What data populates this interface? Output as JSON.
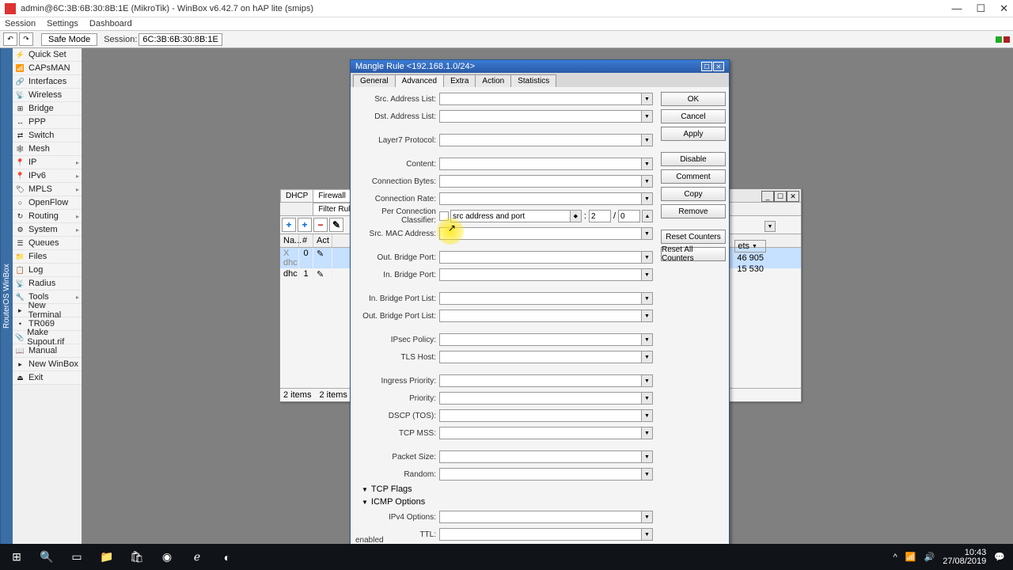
{
  "titlebar": {
    "title": "admin@6C:3B:6B:30:8B:1E (MikroTik) - WinBox v6.42.7 on hAP lite (smips)"
  },
  "menubar": [
    "Session",
    "Settings",
    "Dashboard"
  ],
  "toolbar": {
    "safemode": "Safe Mode",
    "sessionlabel": "Session:",
    "sessionid": "6C:3B:6B:30:8B:1E"
  },
  "nav": [
    "Quick Set",
    "CAPsMAN",
    "Interfaces",
    "Wireless",
    "Bridge",
    "PPP",
    "Switch",
    "Mesh",
    "IP",
    "IPv6",
    "MPLS",
    "OpenFlow",
    "Routing",
    "System",
    "Queues",
    "Files",
    "Log",
    "Radius",
    "Tools",
    "New Terminal",
    "TR069",
    "Make Supout.rif",
    "Manual",
    "New WinBox",
    "Exit"
  ],
  "sidetitle": "RouterOS WinBox",
  "winback": {
    "tabs": [
      "DHCP",
      "Firewall"
    ],
    "subtab": "Filter Rules",
    "headers": {
      "name": "Na...",
      "hash": "#",
      "act": "Act"
    },
    "rows": [
      {
        "name": "dhc",
        "hash": "0",
        "disabled": true
      },
      {
        "name": "dhc",
        "hash": "1",
        "disabled": false
      }
    ],
    "status1": "2 items",
    "status2": "2 items (1 sel",
    "rightvals": [
      "ets",
      "46 905",
      "15 530"
    ]
  },
  "dialog": {
    "title": "Mangle Rule <192.168.1.0/24>",
    "tabs": [
      "General",
      "Advanced",
      "Extra",
      "Action",
      "Statistics"
    ],
    "activeTab": "Advanced",
    "labels": {
      "srcAddrList": "Src. Address List:",
      "dstAddrList": "Dst. Address List:",
      "layer7": "Layer7 Protocol:",
      "content": "Content:",
      "connBytes": "Connection Bytes:",
      "connRate": "Connection Rate:",
      "pcc": "Per Connection Classifier:",
      "srcMac": "Src. MAC Address:",
      "outBridge": "Out. Bridge Port:",
      "inBridge": "In. Bridge Port:",
      "inBridgeList": "In. Bridge Port List:",
      "outBridgeList": "Out. Bridge Port List:",
      "ipsec": "IPsec Policy:",
      "tls": "TLS Host:",
      "ingress": "Ingress Priority:",
      "priority": "Priority:",
      "dscp": "DSCP (TOS):",
      "tcpmss": "TCP MSS:",
      "packetSize": "Packet Size:",
      "random": "Random:",
      "ipv4": "IPv4 Options:",
      "ttl": "TTL:"
    },
    "pcc": {
      "type": "src address and port",
      "num": "2",
      "den": "0"
    },
    "expands": [
      "TCP Flags",
      "ICMP Options"
    ],
    "buttons": [
      "OK",
      "Cancel",
      "Apply",
      "Disable",
      "Comment",
      "Copy",
      "Remove",
      "Reset Counters",
      "Reset All Counters"
    ],
    "status": "enabled"
  },
  "taskbar": {
    "clock": {
      "time": "10:43",
      "date": "27/08/2019"
    }
  }
}
